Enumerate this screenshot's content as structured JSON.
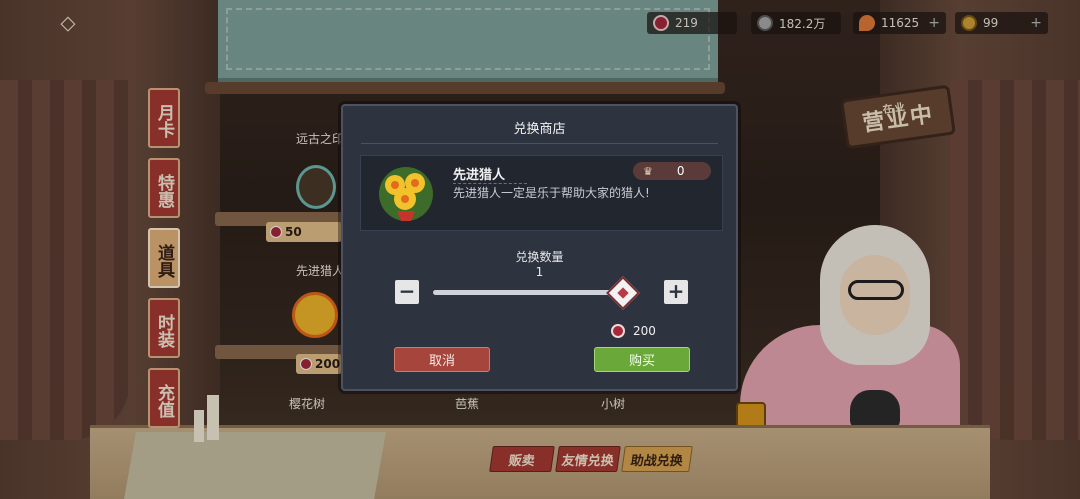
{
  "currencies": [
    {
      "icon": "ruby-coin-icon",
      "value": "219",
      "has_plus": false,
      "color": "#a6293a"
    },
    {
      "icon": "silver-coin-icon",
      "value": "182.2万",
      "has_plus": false,
      "color": "#a9a9a9"
    },
    {
      "icon": "flame-icon",
      "value": "11625",
      "has_plus": true,
      "color": "#e07b39"
    },
    {
      "icon": "gold-coin-icon",
      "value": "99",
      "has_plus": true,
      "color": "#d4a03a"
    }
  ],
  "side_tabs": [
    {
      "label": "月卡",
      "active": false
    },
    {
      "label": "特惠",
      "active": false
    },
    {
      "label": "道具",
      "active": true
    },
    {
      "label": "时装",
      "active": false
    },
    {
      "label": "充值",
      "active": false
    }
  ],
  "shop_bg": {
    "item1_name": "远古之印",
    "item1_price": "50",
    "item2_name": "先进猎人",
    "item2_price": "200",
    "bottom_labels": [
      "樱花树",
      "芭蕉",
      "小树"
    ]
  },
  "bottom_tabs": [
    {
      "label": "贩卖",
      "style": "red"
    },
    {
      "label": "友情兑换",
      "style": "red"
    },
    {
      "label": "助战兑换",
      "style": "gold"
    }
  ],
  "sign_text": "营业中",
  "sign_small": "在业",
  "modal": {
    "title": "兑换商店",
    "item_name": "先进猎人",
    "item_desc": "先进猎人一定是乐于帮助大家的猎人!",
    "owned_icon": "crown-icon",
    "owned_count": "0",
    "qty_label": "兑换数量",
    "qty_value": "1",
    "minus": "−",
    "plus": "+",
    "price": "200",
    "cancel_label": "取消",
    "buy_label": "购买"
  },
  "colors": {
    "modal_bg": "#2e3340",
    "cancel": "#a5453c",
    "buy": "#6aa83a",
    "tab_red": "#a83a34",
    "tab_gold": "#e3b27b"
  }
}
